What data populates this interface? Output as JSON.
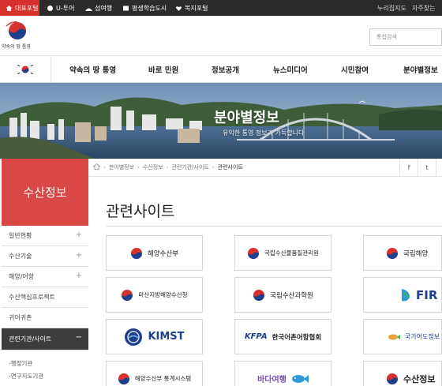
{
  "topbar": {
    "tabs": [
      "대표포털",
      "U-투어",
      "섬여행",
      "평생학습도시",
      "복지포털"
    ],
    "right": [
      "누리집지도",
      "자주찾는"
    ]
  },
  "header": {
    "logo_text": "약속의 땅 통영",
    "search_placeholder": "통합검색"
  },
  "nav": [
    "약속의 땅 통영",
    "바로 민원",
    "정보공개",
    "뉴스미디어",
    "시민참여",
    "분야별정보"
  ],
  "banner": {
    "title": "분야별정보",
    "subtitle": "유익한 통영 정보가 가득합니다"
  },
  "sidebar": {
    "title": "수산정보",
    "items": [
      "일반현황",
      "수산기술",
      "해양/어항",
      "수산핵심프로젝트",
      "귀어귀촌",
      "관련기관/사이트"
    ],
    "subitems": [
      "행정기관",
      "연구지도기관"
    ]
  },
  "breadcrumb": [
    "분야별정보",
    "수산정보",
    "관련기관/사이트",
    "관련사이트"
  ],
  "sns": [
    "f",
    "t",
    "b"
  ],
  "page_title": "관련사이트",
  "cards": [
    {
      "label": "해양수산부"
    },
    {
      "label": "국립수산물품질관리원"
    },
    {
      "label": "국립해양"
    },
    {
      "label": "마산지방해양수산청"
    },
    {
      "label": "국립수산과학원"
    },
    {
      "label": "FIR"
    },
    {
      "label": "KIMST"
    },
    {
      "label": "한국어촌어항협회"
    },
    {
      "label": "국가어도정보"
    },
    {
      "label": "해양수산부 통계시스템"
    },
    {
      "label": "바다여행"
    },
    {
      "label": "수산정보"
    }
  ],
  "colors": {
    "accent": "#d6312d",
    "sidebar_head": "#d94844",
    "active_menu": "#3c3c3c",
    "topbar": "#2b2b2b"
  }
}
